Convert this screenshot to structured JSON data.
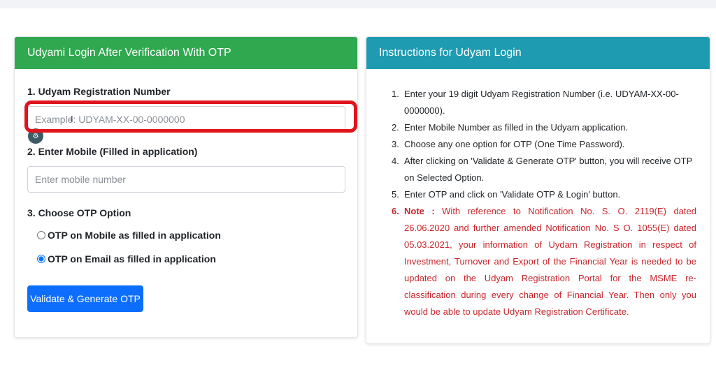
{
  "login_card": {
    "title": "Udyami Login After Verification With OTP",
    "field1_label": "1. Udyam Registration Number",
    "field1_placeholder": "Example: UDYAM-XX-00-0000000",
    "field2_label": "2. Enter Mobile (Filled in application)",
    "field2_placeholder": "Enter mobile number",
    "field3_label": "3. Choose OTP Option",
    "otp_options": [
      {
        "label": "OTP on Mobile as filled in application",
        "selected": false
      },
      {
        "label": "OTP on Email as filled in application",
        "selected": true
      }
    ],
    "submit_label": "Validate & Generate OTP"
  },
  "instructions_card": {
    "title": "Instructions for Udyam Login",
    "items": [
      {
        "num": "1.",
        "text": "Enter your 19 digit Udyam Registration Number (i.e. UDYAM-XX-00-0000000)."
      },
      {
        "num": "2.",
        "text": "Enter Mobile Number as filled in the Udyam application."
      },
      {
        "num": "3.",
        "text": "Choose any one option for OTP (One Time Password)."
      },
      {
        "num": "4.",
        "text": "After clicking on 'Validate & Generate OTP' button, you will receive OTP on Selected Option."
      },
      {
        "num": "5.",
        "text": "Enter OTP and click on 'Validate OTP & Login' button."
      }
    ],
    "note": {
      "num": "6.",
      "prefix": "Note :",
      "text": "With reference to Notification No. S. O. 2119(E) dated 26.06.2020 and further amended Notification No. S O. 1055(E) dated 05.03.2021, your information of Uydam Registration in respect of Investment, Turnover and Export of the Financial Year is needed to be updated on the Udyam Registration Portal for the MSME re-classification during every change of Financial Year. Then only you would be able to update Udyam Registration Certificate."
    }
  },
  "colors": {
    "login_header": "#2fa84f",
    "instructions_header": "#1f9bb1",
    "primary_button": "#0d6efd",
    "note_text": "#c9252b",
    "highlight_box": "#e0141c"
  }
}
